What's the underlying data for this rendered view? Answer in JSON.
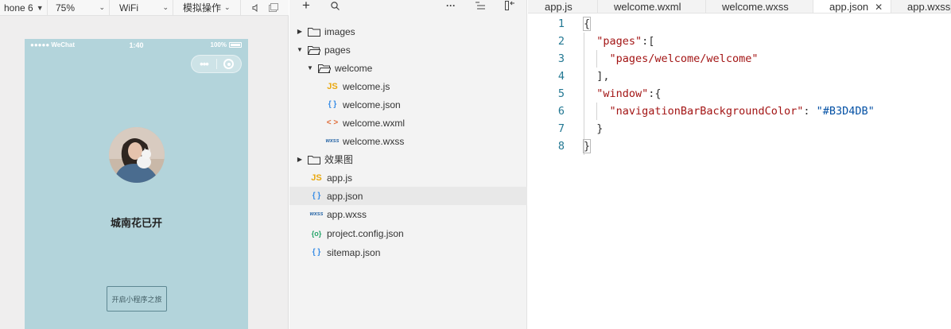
{
  "toolbar": {
    "device": "hone 6",
    "zoom": "75%",
    "network": "WiFi",
    "action": "模拟操作"
  },
  "simulator": {
    "status_left": "●●●●● WeChat",
    "time": "1:40",
    "battery": "100%",
    "nickname": "城南花已开",
    "start_button": "开启小程序之旅",
    "background_color": "#B3D4DB"
  },
  "explorer": {
    "items": [
      {
        "label": "images",
        "type": "folder",
        "expanded": false,
        "depth": 0
      },
      {
        "label": "pages",
        "type": "folder",
        "expanded": true,
        "depth": 0
      },
      {
        "label": "welcome",
        "type": "folder",
        "expanded": true,
        "depth": 1
      },
      {
        "label": "welcome.js",
        "type": "js",
        "depth": 2
      },
      {
        "label": "welcome.json",
        "type": "json",
        "depth": 2
      },
      {
        "label": "welcome.wxml",
        "type": "wxml",
        "depth": 2
      },
      {
        "label": "welcome.wxss",
        "type": "wxss",
        "depth": 2
      },
      {
        "label": "效果图",
        "type": "folder",
        "expanded": false,
        "depth": 0
      },
      {
        "label": "app.js",
        "type": "js",
        "depth": 0
      },
      {
        "label": "app.json",
        "type": "json",
        "depth": 0,
        "selected": true
      },
      {
        "label": "app.wxss",
        "type": "wxss",
        "depth": 0
      },
      {
        "label": "project.config.json",
        "type": "config",
        "depth": 0
      },
      {
        "label": "sitemap.json",
        "type": "json",
        "depth": 0
      }
    ]
  },
  "editor": {
    "tabs": [
      {
        "label": "app.js",
        "active": false
      },
      {
        "label": "welcome.wxml",
        "active": false
      },
      {
        "label": "welcome.wxss",
        "active": false
      },
      {
        "label": "app.json",
        "active": true
      },
      {
        "label": "app.wxss",
        "active": false
      }
    ],
    "lines": [
      {
        "n": "1",
        "text": "{"
      },
      {
        "n": "2",
        "text": "  \"pages\":["
      },
      {
        "n": "3",
        "text": "    \"pages/welcome/welcome\""
      },
      {
        "n": "4",
        "text": "  ],"
      },
      {
        "n": "5",
        "text": "  \"window\":{"
      },
      {
        "n": "6",
        "text": "    \"navigationBarBackgroundColor\": \"#B3D4DB\""
      },
      {
        "n": "7",
        "text": "  }"
      },
      {
        "n": "8",
        "text": "}"
      }
    ]
  }
}
